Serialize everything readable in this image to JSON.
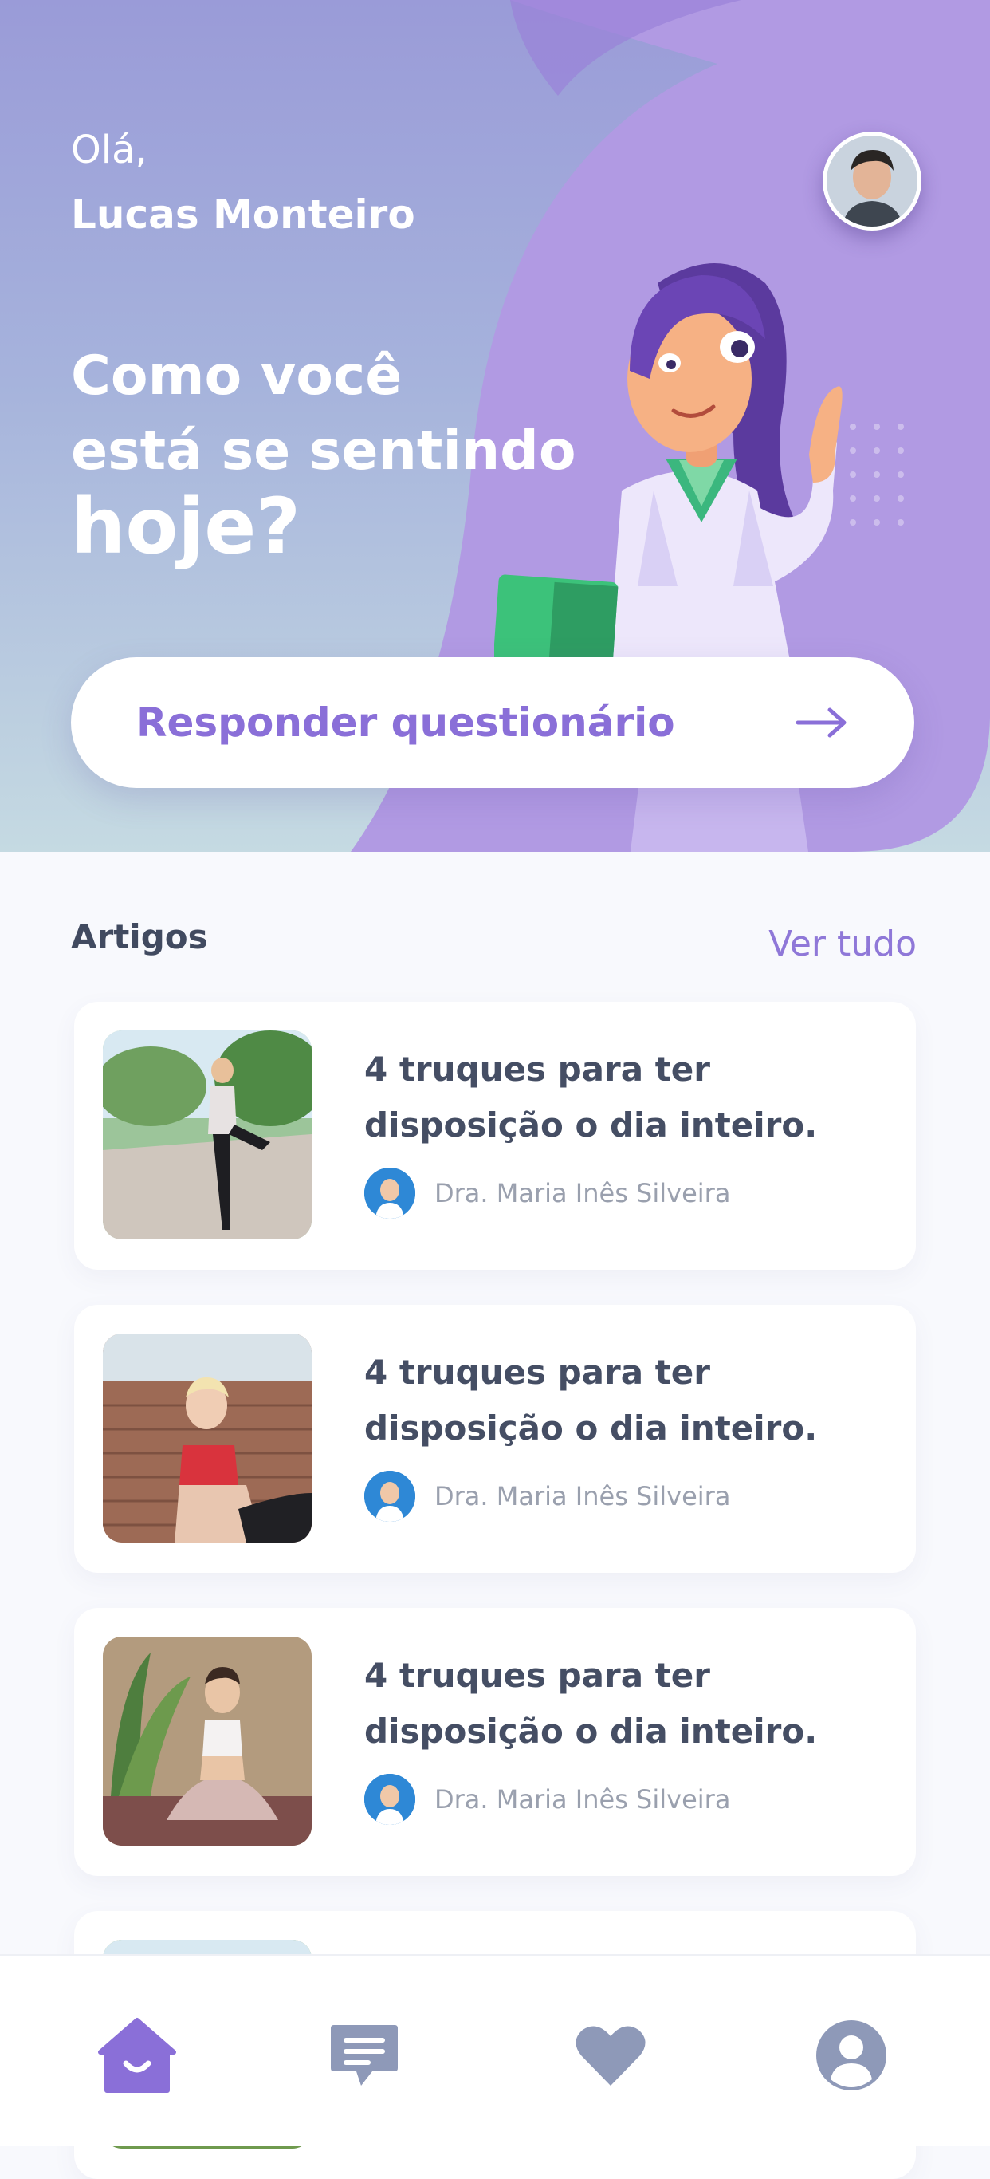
{
  "header": {
    "greeting": "Olá,",
    "user_name": "Lucas Monteiro",
    "headline_line1": "Como você",
    "headline_line2": "está se sentindo",
    "headline_line3": "hoje?",
    "cta_label": "Responder questionário"
  },
  "articles": {
    "section_title": "Artigos",
    "see_all": "Ver tudo",
    "items": [
      {
        "title": "4 truques para ter disposição o dia inteiro.",
        "author": "Dra. Maria Inês Silveira",
        "image": "woman-stretching-outdoors"
      },
      {
        "title": "4 truques para ter disposição o dia inteiro.",
        "author": "Dra. Maria Inês Silveira",
        "image": "woman-leaning-on-brick-wall"
      },
      {
        "title": "4 truques para ter disposição o dia inteiro.",
        "author": "Dra. Maria Inês Silveira",
        "image": "woman-meditating"
      }
    ]
  },
  "nav": {
    "items": [
      {
        "icon": "home-icon",
        "active": true
      },
      {
        "icon": "chat-icon",
        "active": false
      },
      {
        "icon": "heart-icon",
        "active": false
      },
      {
        "icon": "profile-icon",
        "active": false
      }
    ]
  },
  "colors": {
    "accent": "#8a6fd8",
    "nav_inactive": "#8e99b8",
    "title_text": "#454e64"
  }
}
